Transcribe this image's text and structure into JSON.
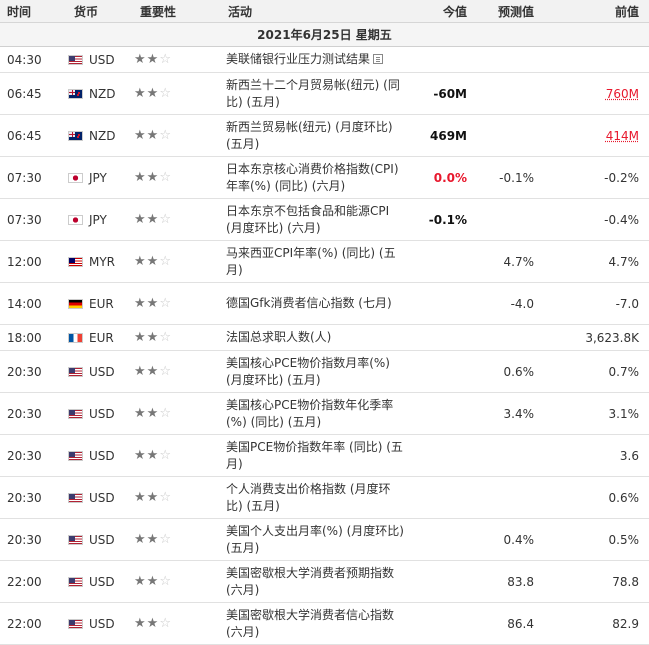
{
  "header": {
    "time": "时间",
    "currency": "货币",
    "importance": "重要性",
    "event": "活动",
    "actual": "今值",
    "forecast": "预测值",
    "previous": "前值"
  },
  "date_label": "2021年6月25日  星期五",
  "colors": {
    "red": "#e8182d",
    "header_bg": "#f2f2f2"
  },
  "rows": [
    {
      "time": "04:30",
      "flag": "us",
      "currency": "USD",
      "stars": 2,
      "event": "美联储银行业压力测试结果",
      "icon": "document-icon",
      "actual": "",
      "forecast": "",
      "previous": ""
    },
    {
      "time": "06:45",
      "flag": "nz",
      "currency": "NZD",
      "stars": 2,
      "event": "新西兰十二个月贸易帐(纽元) (同比) (五月)",
      "actual": "-60M",
      "forecast": "",
      "previous": "760M",
      "previous_style": "revised"
    },
    {
      "time": "06:45",
      "flag": "nz",
      "currency": "NZD",
      "stars": 2,
      "event": "新西兰贸易帐(纽元) (月度环比) (五月)",
      "actual": "469M",
      "forecast": "",
      "previous": "414M",
      "previous_style": "revised"
    },
    {
      "time": "07:30",
      "flag": "jp",
      "currency": "JPY",
      "stars": 2,
      "event": "日本东京核心消费价格指数(CPI)年率(%) (同比) (六月)",
      "actual": "0.0%",
      "actual_style": "red",
      "forecast": "-0.1%",
      "previous": "-0.2%"
    },
    {
      "time": "07:30",
      "flag": "jp",
      "currency": "JPY",
      "stars": 2,
      "event": "日本东京不包括食品和能源CPI (月度环比) (六月)",
      "actual": "-0.1%",
      "forecast": "",
      "previous": "-0.4%"
    },
    {
      "time": "12:00",
      "flag": "my",
      "currency": "MYR",
      "stars": 2,
      "event": "马来西亚CPI年率(%) (同比) (五月)",
      "actual": "",
      "forecast": "4.7%",
      "previous": "4.7%"
    },
    {
      "time": "14:00",
      "flag": "de",
      "currency": "EUR",
      "stars": 2,
      "event": "德国Gfk消费者信心指数 (七月)",
      "actual": "",
      "forecast": "-4.0",
      "previous": "-7.0"
    },
    {
      "time": "18:00",
      "flag": "fr",
      "currency": "EUR",
      "stars": 2,
      "event": "法国总求职人数(人)",
      "actual": "",
      "forecast": "",
      "previous": "3,623.8K"
    },
    {
      "time": "20:30",
      "flag": "us",
      "currency": "USD",
      "stars": 2,
      "event": "美国核心PCE物价指数月率(%) (月度环比) (五月)",
      "actual": "",
      "forecast": "0.6%",
      "previous": "0.7%"
    },
    {
      "time": "20:30",
      "flag": "us",
      "currency": "USD",
      "stars": 2,
      "event": "美国核心PCE物价指数年化季率(%) (同比) (五月)",
      "actual": "",
      "forecast": "3.4%",
      "previous": "3.1%"
    },
    {
      "time": "20:30",
      "flag": "us",
      "currency": "USD",
      "stars": 2,
      "event": "美国PCE物价指数年率 (同比) (五月)",
      "actual": "",
      "forecast": "",
      "previous": "3.6"
    },
    {
      "time": "20:30",
      "flag": "us",
      "currency": "USD",
      "stars": 2,
      "event": "个人消费支出价格指数 (月度环比) (五月)",
      "actual": "",
      "forecast": "",
      "previous": "0.6%"
    },
    {
      "time": "20:30",
      "flag": "us",
      "currency": "USD",
      "stars": 2,
      "event": "美国个人支出月率(%) (月度环比) (五月)",
      "actual": "",
      "forecast": "0.4%",
      "previous": "0.5%"
    },
    {
      "time": "22:00",
      "flag": "us",
      "currency": "USD",
      "stars": 2,
      "event": "美国密歇根大学消费者预期指数 (六月)",
      "actual": "",
      "forecast": "83.8",
      "previous": "78.8"
    },
    {
      "time": "22:00",
      "flag": "us",
      "currency": "USD",
      "stars": 2,
      "event": "美国密歇根大学消费者信心指数 (六月)",
      "actual": "",
      "forecast": "86.4",
      "previous": "82.9"
    }
  ]
}
